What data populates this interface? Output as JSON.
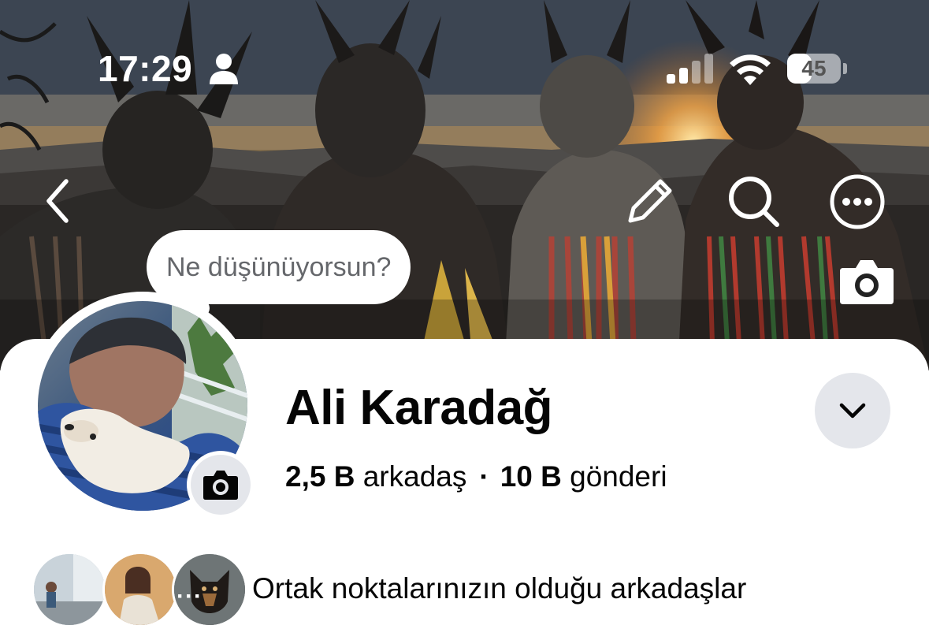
{
  "status_bar": {
    "time": "17:29",
    "battery": "45",
    "battery_level": 0.45,
    "icons": [
      "person-icon",
      "cellular-signal-icon",
      "wifi-icon",
      "battery-icon"
    ]
  },
  "nav": {
    "icons": [
      "chevron-left-icon",
      "pencil-icon",
      "search-icon",
      "more-horizontal-icon",
      "camera-icon"
    ]
  },
  "bubble": {
    "text": "Ne düşünüyorsun?"
  },
  "profile": {
    "name": "Ali Karadağ",
    "friends_count": "2,5 B",
    "friends_label": "arkadaş",
    "separator": "·",
    "posts_count": "10 B",
    "posts_label": "gönderi"
  },
  "mutual": {
    "label": "Ortak noktalarınızın olduğu arkadaşlar",
    "more": "···"
  },
  "colors": {
    "text_primary": "#050505",
    "text_secondary": "#65676b",
    "button_gray": "#e4e6eb"
  }
}
